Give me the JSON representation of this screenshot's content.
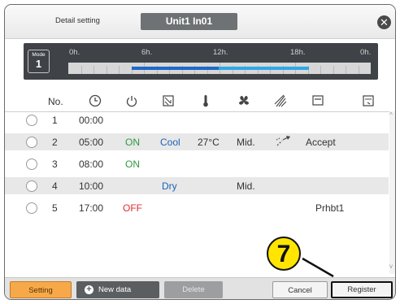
{
  "header": {
    "label": "Detail setting",
    "unit_name": "Unit1 In01",
    "close_icon": "close-icon"
  },
  "timeline": {
    "mode_label": "Mode",
    "mode_value": "1",
    "ticks": [
      "0h.",
      "6h.",
      "12h.",
      "18h.",
      "0h."
    ]
  },
  "columns": {
    "no": "No.",
    "icons": [
      "clock-icon",
      "power-icon",
      "mode-icon",
      "thermometer-icon",
      "fan-icon",
      "louver-icon",
      "remote-icon",
      "lock-icon"
    ]
  },
  "rows": [
    {
      "no": "1",
      "time": "00:00",
      "power": "",
      "mode": "",
      "temp": "",
      "fan": "",
      "louver": "",
      "remote": ""
    },
    {
      "no": "2",
      "time": "05:00",
      "power": "ON",
      "mode": "Cool",
      "temp": "27°C",
      "fan": "Mid.",
      "louver": "",
      "remote": "Accept"
    },
    {
      "no": "3",
      "time": "08:00",
      "power": "ON",
      "mode": "",
      "temp": "",
      "fan": "",
      "louver": "",
      "remote": ""
    },
    {
      "no": "4",
      "time": "10:00",
      "power": "",
      "mode": "Dry",
      "temp": "",
      "fan": "Mid.",
      "louver": "",
      "remote": ""
    },
    {
      "no": "5",
      "time": "17:00",
      "power": "OFF",
      "mode": "",
      "temp": "",
      "fan": "",
      "louver": "",
      "remote": "Prhbt1"
    }
  ],
  "footer": {
    "setting": "Setting",
    "new_data": "New data",
    "delete": "Delete",
    "cancel": "Cancel",
    "register": "Register"
  },
  "callout": {
    "number": "7"
  },
  "colors": {
    "on": "#2e9a3e",
    "off": "#e02c2c",
    "mode": "#1a63b8",
    "setting_btn": "#f7a94a",
    "badge": "#ffe500"
  }
}
